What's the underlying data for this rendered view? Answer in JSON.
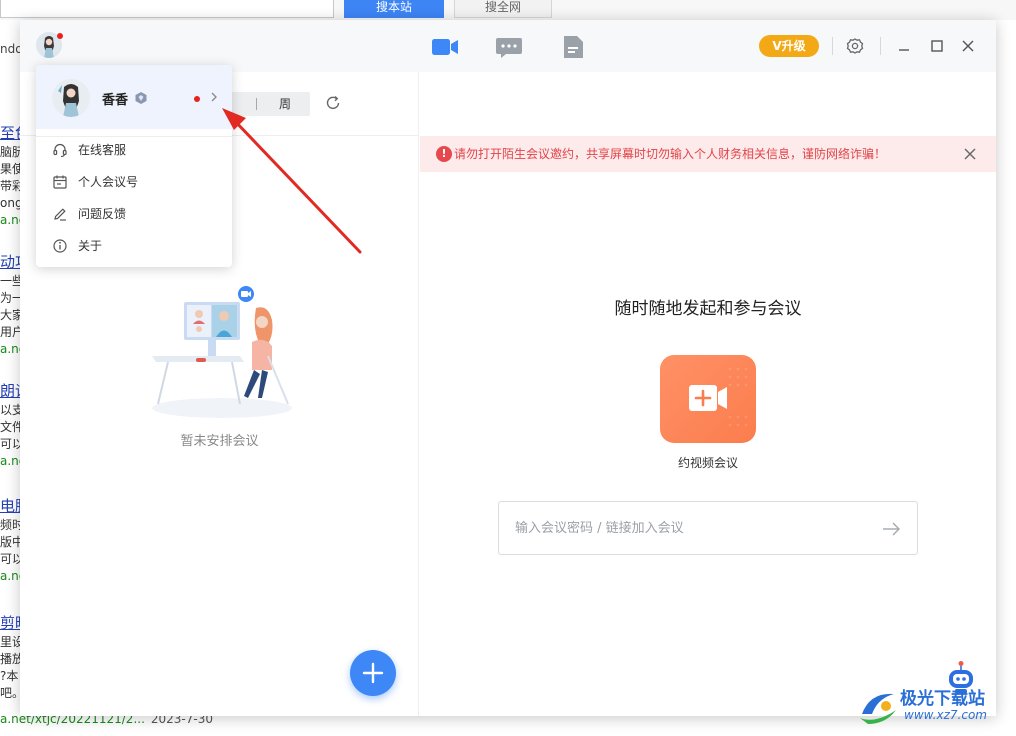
{
  "background": {
    "buttons": {
      "search_site": "搜本站",
      "search_web": "搜全网"
    },
    "tab_fragment": "ndo",
    "results": [
      {
        "title": "至色",
        "lines": [
          "脑朊",
          "果使",
          "带彩",
          "ong"
        ],
        "url": "a.ne"
      },
      {
        "title": "动功",
        "lines": [
          "一些",
          "为一",
          "大家",
          "用户"
        ],
        "url": "a.ne"
      },
      {
        "title": "朗读",
        "lines": [
          "以支",
          "文件",
          "可以"
        ],
        "url": "a.ne"
      },
      {
        "title": "电脑",
        "lines": [
          "频时",
          "版中",
          "可以"
        ],
        "url": "a.ne"
      },
      {
        "title": "剪映",
        "lines": [
          "里设",
          "播放",
          "?本",
          "吧。"
        ],
        "url": "a.ne"
      }
    ],
    "bottom_url": "a.net/xtjc/20221121/2...",
    "bottom_date": "2023-7-30"
  },
  "titlebar": {
    "nav": [
      "video-camera-icon",
      "chat-bubble-icon",
      "document-icon"
    ],
    "vip_label": "V升级",
    "controls": [
      "settings-icon",
      "minimize-icon",
      "maximize-icon",
      "close-icon"
    ]
  },
  "menu": {
    "user_name": "香香",
    "items": [
      {
        "label": "在线客服",
        "icon": "headset-icon"
      },
      {
        "label": "个人会议号",
        "icon": "calendar-icon"
      },
      {
        "label": "问题反馈",
        "icon": "pencil-icon"
      },
      {
        "label": "关于",
        "icon": "info-icon"
      }
    ]
  },
  "left_panel": {
    "week_tab": "周",
    "empty_text": "暂未安排会议"
  },
  "right_panel": {
    "warning": "请勿打开陌生会议邀约，共享屏幕时切勿输入个人财务相关信息，谨防网络诈骗！",
    "title": "随时随地发起和参与会议",
    "video_button_label": "约视频会议",
    "join_placeholder": "输入会议密码 / 链接加入会议"
  },
  "watermark": {
    "name": "极光下载站",
    "url": "www.xz7.com"
  },
  "colors": {
    "primary": "#3e87f7",
    "vip": "#f3a915",
    "video_button": "#fb7d4d",
    "warning_text": "#e0454a",
    "warning_bg": "#fdeaea",
    "annotation": "#e02a22"
  }
}
